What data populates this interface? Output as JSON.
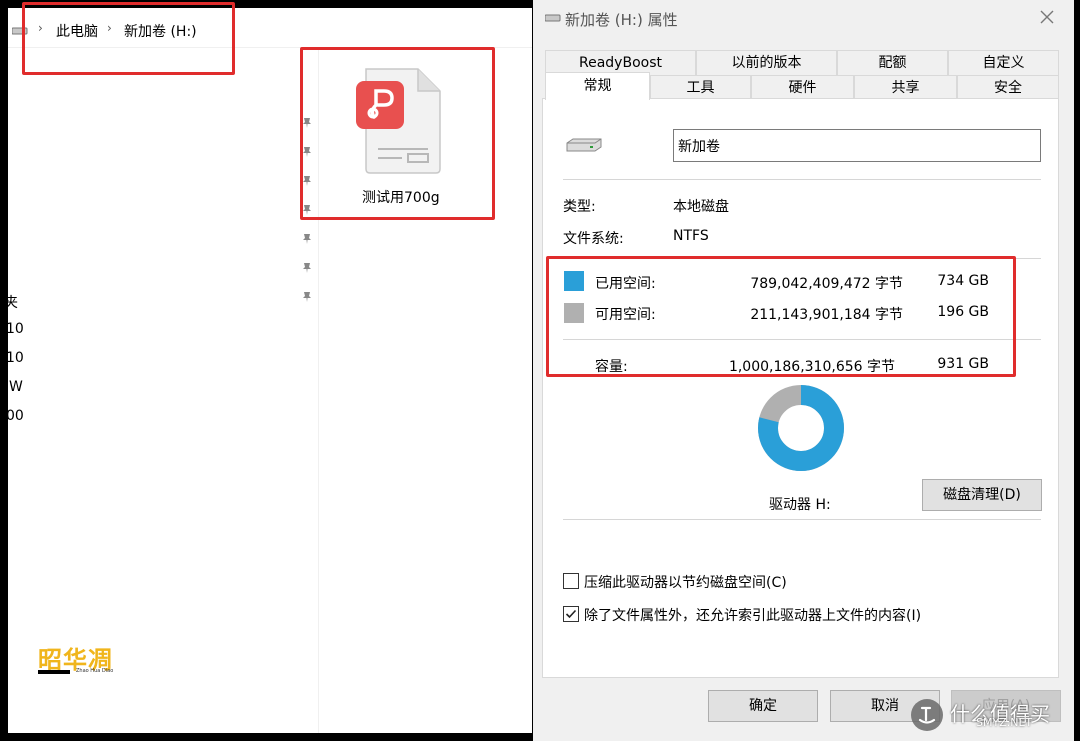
{
  "explorer": {
    "breadcrumb": [
      "此电脑",
      "新加卷 (H:)"
    ],
    "file": {
      "name": "测试用700g",
      "icon": "pdf-document-icon"
    },
    "nav_fragments": [
      "夹",
      "10",
      "10",
      "W",
      "00"
    ]
  },
  "watermark": {
    "logo_icon": "zhaohuadiao-logo",
    "caption": "Zhao Hua Diao",
    "site": "什么值得买",
    "site_sub": "SMYZ.NET"
  },
  "dialog": {
    "title": "新加卷 (H:) 属性",
    "tabs_row1": [
      "ReadyBoost",
      "以前的版本",
      "配额",
      "自定义"
    ],
    "tabs_row2": [
      "常规",
      "工具",
      "硬件",
      "共享",
      "安全"
    ],
    "active_tab": "常规",
    "volume_name": "新加卷",
    "type_label": "类型:",
    "type_value": "本地磁盘",
    "fs_label": "文件系统:",
    "fs_value": "NTFS",
    "used": {
      "label": "已用空间:",
      "bytes": "789,042,409,472 字节",
      "size": "734 GB",
      "color": "#2a9fd8"
    },
    "free": {
      "label": "可用空间:",
      "bytes": "211,143,901,184 字节",
      "size": "196 GB",
      "color": "#b0b0b0"
    },
    "capacity": {
      "label": "容量:",
      "bytes": "1,000,186,310,656 字节",
      "size": "931 GB"
    },
    "used_fraction": 0.789,
    "drive_label": "驱动器 H:",
    "cleanup_button": "磁盘清理(D)",
    "compress_checkbox": {
      "label": "压缩此驱动器以节约磁盘空间(C)",
      "checked": false
    },
    "index_checkbox": {
      "label": "除了文件属性外，还允许索引此驱动器上文件的内容(I)",
      "checked": true
    },
    "ok_button": "确定",
    "cancel_button": "取消",
    "apply_button": "应用(A)"
  }
}
